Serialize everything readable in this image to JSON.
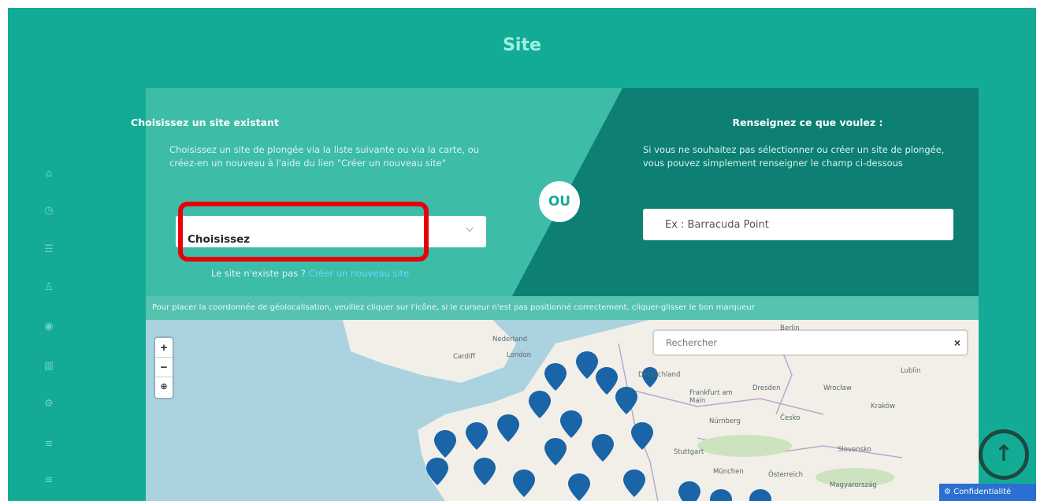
{
  "page": {
    "title": "Site"
  },
  "sidebar": {
    "icons": [
      "home-icon",
      "clock-icon",
      "list-icon",
      "user-icon",
      "eye-icon",
      "book-icon",
      "gear-icon",
      "menu-icon",
      "menu-icon"
    ]
  },
  "left": {
    "title": "Choisissez un site existant",
    "description": "Choisissez un site de plongée via la liste suivante ou via la carte, ou créez-en un nouveau à l'aide du lien \"Créer un nouveau site\"",
    "select_value": "Choisissez",
    "not_exist_text": "Le site n'existe pas ?",
    "create_link": "Créer un nouveau site"
  },
  "ou_label": "OU",
  "right": {
    "title": "Renseignez ce que voulez :",
    "description": "Si vous ne souhaitez pas sélectionner ou créer un site de plongée, vous pouvez simplement renseigner le champ ci-dessous",
    "input_placeholder": "Ex : Barracuda Point"
  },
  "map": {
    "hint": "Pour placer la coordonnée de géolocalisation, veuillez cliquer sur l'icône, si le curseur n'est pas positionné correctement, cliquer-glisser le bon marqueur",
    "zoom_in": "+",
    "zoom_out": "−",
    "locate": "⊕",
    "search_placeholder": "Rechercher",
    "search_close": "×",
    "places": {
      "berlin": "Berlin",
      "nederland": "Nederland",
      "cardiff": "Cardiff",
      "london": "London",
      "deutschland": "Deutschland",
      "lublin": "Lublin",
      "frankfurt": "Frankfurt am Main",
      "dresden": "Dresden",
      "wroclaw": "Wrocław",
      "krakow": "Kraków",
      "nurnberg": "Nürnberg",
      "cesko": "Česko",
      "stuttgart": "Stuttgart",
      "munchen": "München",
      "osterreich": "Österreich",
      "slovensko": "Slovensko",
      "magyarorszag": "Magyarország"
    },
    "marker_color": "#1a64a8"
  },
  "confidentiality": "Confidentialité",
  "colors": {
    "accent": "#14ab96",
    "dark_panel": "#0d7f73",
    "highlight": "#e8000b",
    "link": "#6fd6ff"
  }
}
